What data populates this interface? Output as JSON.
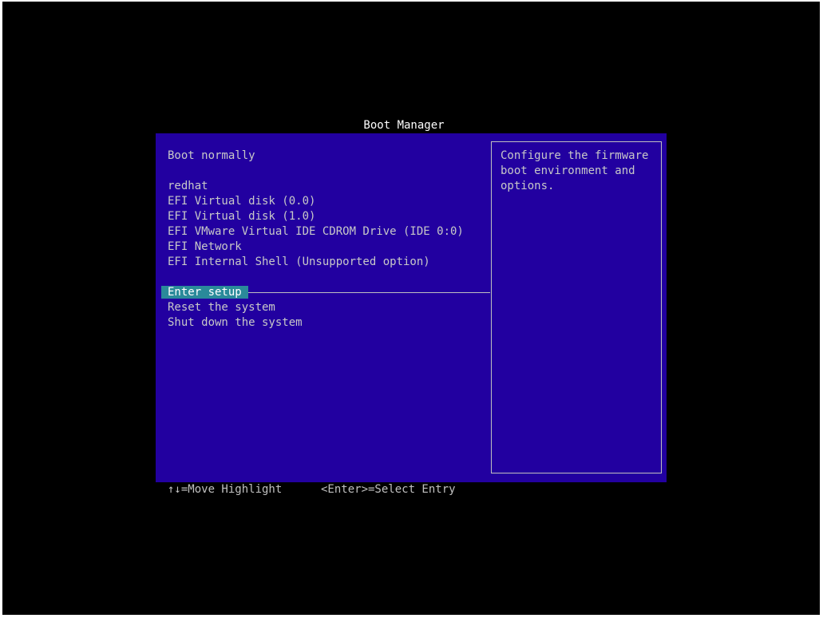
{
  "title": "Boot Manager",
  "menu": {
    "boot_normally": "Boot normally",
    "entries": [
      "redhat",
      "EFI Virtual disk (0.0)",
      "EFI Virtual disk (1.0)",
      "EFI VMware Virtual IDE CDROM Drive (IDE 0:0)",
      "EFI Network",
      "EFI Internal Shell (Unsupported option)"
    ],
    "enter_setup": "Enter setup",
    "reset": "Reset the system",
    "shutdown": "Shut down the system"
  },
  "help": {
    "text": "Configure the firmware boot environment and options."
  },
  "footer": {
    "move": "↑↓=Move Highlight",
    "select": "<Enter>=Select Entry"
  },
  "colors": {
    "background": "#000000",
    "panel": "#2200a0",
    "highlight": "#2a8a9a",
    "text": "#c8c8c8"
  }
}
